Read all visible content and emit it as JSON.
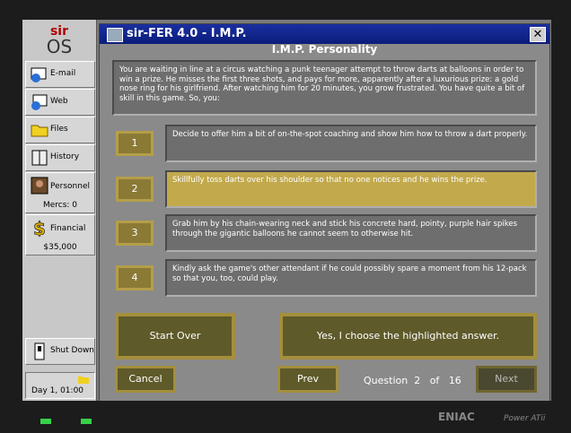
{
  "sidebar": {
    "logo_top": "sir",
    "logo_bottom": "OS",
    "items": [
      {
        "label": "E-mail",
        "icon": "email-icon"
      },
      {
        "label": "Web",
        "icon": "web-icon"
      },
      {
        "label": "Files",
        "icon": "folder-icon"
      },
      {
        "label": "History",
        "icon": "book-icon"
      },
      {
        "label": "Personnel",
        "sub": "Mercs: 0",
        "icon": "personnel-icon"
      },
      {
        "label": "Financial",
        "sub": "$35,000",
        "icon": "dollar-icon"
      },
      {
        "label": "Shut Down",
        "icon": "power-icon"
      }
    ],
    "date": "Day 1, 01:00"
  },
  "window": {
    "title": "sir-FER 4.0   -   I.M.P.",
    "close_label": "✕",
    "subtitle": "I.M.P. Personality",
    "question": "You are waiting in line at a circus watching a punk teenager attempt to throw darts at balloons in order to win a prize. He misses the first three shots, and pays for more, apparently after a luxurious prize: a gold nose ring for his girlfriend. After watching him for 20 minutes, you grow frustrated. You have quite a bit of skill in this game. So, you:",
    "answers": [
      {
        "num": "1",
        "text": "Decide to offer him a bit of on-the-spot coaching and show him how to throw a dart properly."
      },
      {
        "num": "2",
        "text": "Skillfully toss darts over his shoulder so that no one notices and he wins the prize."
      },
      {
        "num": "3",
        "text": "Grab him by his chain-wearing neck and stick his concrete hard, pointy, purple hair spikes through the gigantic balloons he cannot seem to otherwise hit."
      },
      {
        "num": "4",
        "text": "Kindly ask the game's other attendant if he could possibly spare a moment from his 12-pack so that you, too, could play."
      }
    ],
    "selected_answer": 2,
    "start_over": "Start Over",
    "confirm": "Yes, I choose the highlighted answer.",
    "cancel": "Cancel",
    "prev": "Prev",
    "next": "Next",
    "question_label": "Question",
    "question_num": "2",
    "of_label": "of",
    "question_total": "16"
  },
  "footer": {
    "brand": "ENIAC",
    "model": "Power ATii"
  },
  "colors": {
    "title_bar": "#0b1c7a",
    "selected": "#c2a94c",
    "button_frame": "#a48f3c"
  }
}
